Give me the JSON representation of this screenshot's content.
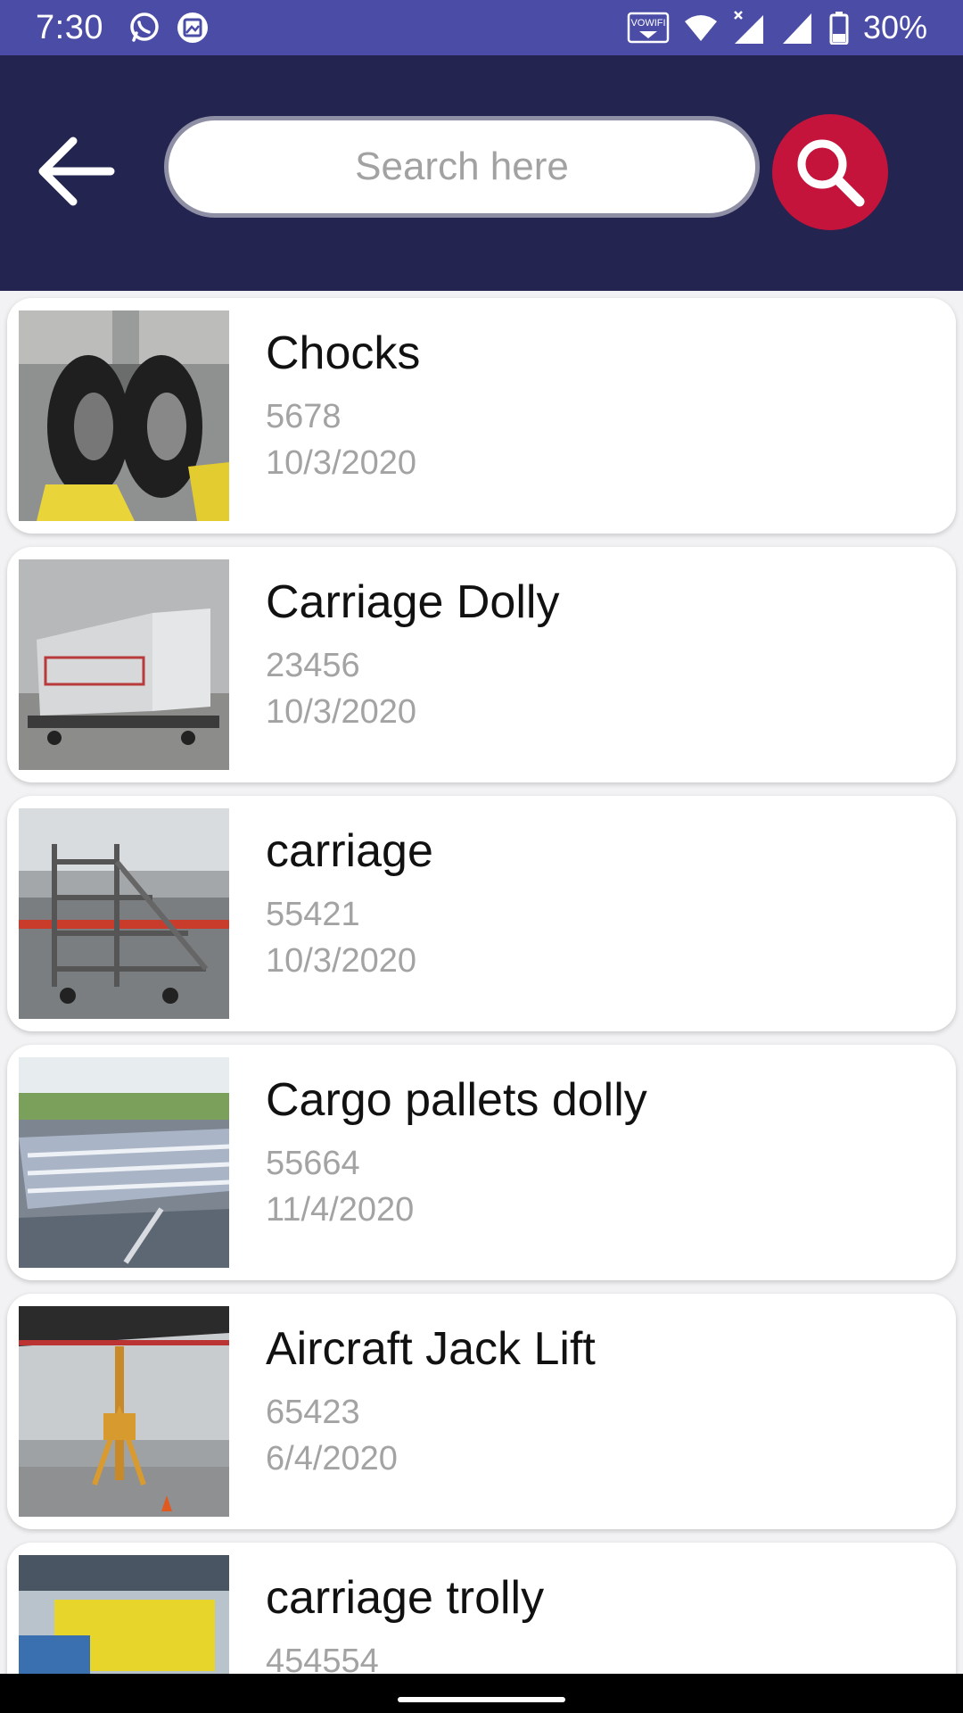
{
  "status_bar": {
    "time": "7:30",
    "battery": "30%",
    "icons": [
      "whatsapp-icon",
      "gallery-icon",
      "vowifi-icon",
      "wifi-icon",
      "signal-icon",
      "battery-icon"
    ],
    "vowifi_label": "VOWIFI"
  },
  "header": {
    "back_icon": "back-arrow-icon",
    "search_placeholder": "Search here",
    "search_value": "",
    "search_icon": "search-icon"
  },
  "colors": {
    "status_bar": "#4a4ca6",
    "header": "#23244f",
    "search_button": "#c4143c"
  },
  "items": [
    {
      "title": "Chocks",
      "code": "5678",
      "date": "10/3/2020",
      "image": "aircraft-wheel-chocks-photo"
    },
    {
      "title": "Carriage Dolly",
      "code": "23456",
      "date": "10/3/2020",
      "image": "cargo-container-dolly-photo"
    },
    {
      "title": "carriage",
      "code": "55421",
      "date": "10/3/2020",
      "image": "boarding-stair-carriage-photo"
    },
    {
      "title": "Cargo pallets dolly",
      "code": "55664",
      "date": "11/4/2020",
      "image": "cargo-pallet-dollies-photo"
    },
    {
      "title": "Aircraft Jack Lift",
      "code": "65423",
      "date": "6/4/2020",
      "image": "aircraft-jack-lift-photo"
    },
    {
      "title": "carriage trolly",
      "code": "454554",
      "date": "",
      "image": "carriage-trolly-photo"
    }
  ]
}
